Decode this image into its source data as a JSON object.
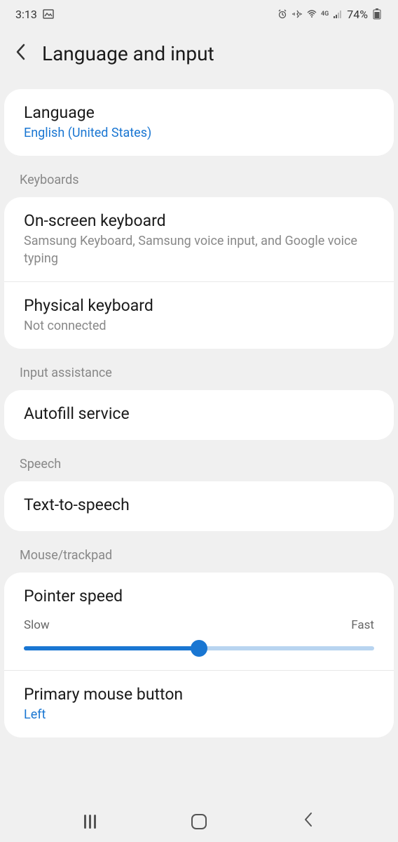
{
  "statusBar": {
    "time": "3:13",
    "battery": "74%",
    "networkLabel": "4G"
  },
  "header": {
    "title": "Language and input"
  },
  "language": {
    "title": "Language",
    "value": "English (United States)"
  },
  "sections": {
    "keyboards": "Keyboards",
    "inputAssistance": "Input assistance",
    "speech": "Speech",
    "mouseTrackpad": "Mouse/trackpad"
  },
  "keyboards": {
    "onScreen": {
      "title": "On-screen keyboard",
      "subtitle": "Samsung Keyboard, Samsung voice input, and Google voice typing"
    },
    "physical": {
      "title": "Physical keyboard",
      "subtitle": "Not connected"
    }
  },
  "inputAssistance": {
    "autofill": "Autofill service"
  },
  "speech": {
    "tts": "Text-to-speech"
  },
  "mouseTrackpad": {
    "pointerSpeed": {
      "title": "Pointer speed",
      "slowLabel": "Slow",
      "fastLabel": "Fast",
      "value": 50
    },
    "primaryButton": {
      "title": "Primary mouse button",
      "value": "Left"
    }
  },
  "colors": {
    "accent": "#1976d2",
    "background": "#f0f0f0",
    "cardBackground": "#ffffff",
    "textPrimary": "#1a1a1a",
    "textSecondary": "#888888"
  }
}
